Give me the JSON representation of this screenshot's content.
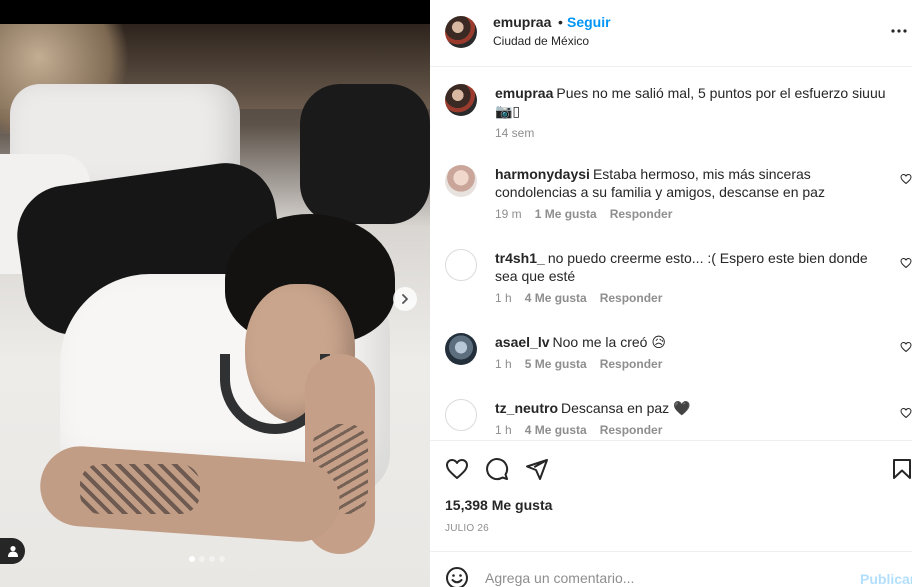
{
  "post": {
    "username": "emupraa",
    "separator": "•",
    "follow_label": "Seguir",
    "location": "Ciudad de México",
    "media_dots": 4,
    "active_dot": 1
  },
  "caption": {
    "username": "emupraa",
    "text": "Pues no me salió mal, 5 puntos por el esfuerzo siuuu 📷▯",
    "time": "14 sem"
  },
  "comments": [
    {
      "username": "harmonydaysi",
      "text": "Estaba hermoso, mis más sinceras condolencias a su familia y amigos, descanse en paz",
      "time": "19 m",
      "likes": "1 Me gusta",
      "reply": "Responder"
    },
    {
      "username": "tr4sh1_",
      "text": "no puedo creerme esto... :( Espero este bien donde sea que esté",
      "time": "1 h",
      "likes": "4 Me gusta",
      "reply": "Responder"
    },
    {
      "username": "asael_lv",
      "text": "Noo me la creó 😥",
      "time": "1 h",
      "likes": "5 Me gusta",
      "reply": "Responder"
    },
    {
      "username": "tz_neutro",
      "text": "Descansa en paz 🖤",
      "time": "1 h",
      "likes": "4 Me gusta",
      "reply": "Responder"
    }
  ],
  "stats": {
    "likes": "15,398 Me gusta",
    "date": "JULIO 26"
  },
  "composer": {
    "placeholder": "Agrega un comentario...",
    "publish_label": "Publicar"
  },
  "icons": {
    "like": "heart-icon",
    "comment": "comment-icon",
    "share": "send-icon",
    "save": "bookmark-icon",
    "emoji": "emoji-icon",
    "more": "more-icon",
    "next": "chevron-right-icon",
    "tag": "user-tag-icon"
  },
  "colors": {
    "link_blue": "#0095f6",
    "publish_disabled": "#b2dffc",
    "secondary_text": "#8e8e8e"
  }
}
